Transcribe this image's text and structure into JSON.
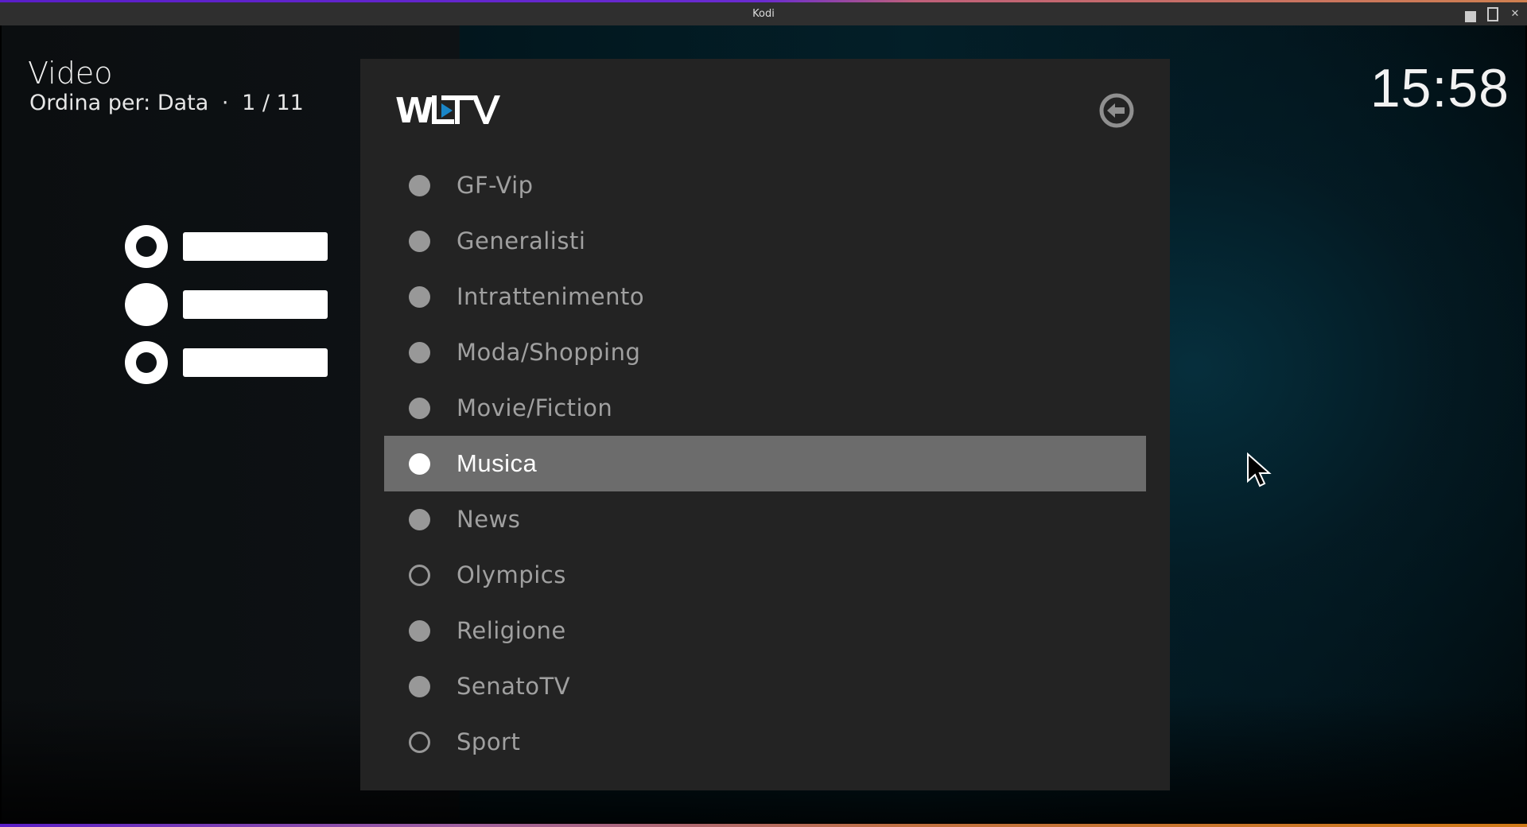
{
  "window": {
    "title": "Kodi",
    "controls": [
      "minimize",
      "maximize",
      "close"
    ]
  },
  "header": {
    "title": "Video",
    "sort_label": "Ordina per: Data",
    "separator": "·",
    "position": "1 / 11"
  },
  "clock": "15:58",
  "view_icon": "list-view-icon",
  "panel": {
    "logo_text": "WLTV",
    "logo_accent": "#1a86c8",
    "back_icon": "back-arrow-circle-icon",
    "items": [
      {
        "label": "GF-Vip",
        "state": "on",
        "focused": false
      },
      {
        "label": "Generalisti",
        "state": "on",
        "focused": false
      },
      {
        "label": "Intrattenimento",
        "state": "on",
        "focused": false
      },
      {
        "label": "Moda/Shopping",
        "state": "on",
        "focused": false
      },
      {
        "label": "Movie/Fiction",
        "state": "on",
        "focused": false
      },
      {
        "label": "Musica",
        "state": "on",
        "focused": true
      },
      {
        "label": "News",
        "state": "on",
        "focused": false
      },
      {
        "label": "Olympics",
        "state": "off",
        "focused": false
      },
      {
        "label": "Religione",
        "state": "on",
        "focused": false
      },
      {
        "label": "SenatoTV",
        "state": "on",
        "focused": false
      },
      {
        "label": "Sport",
        "state": "off",
        "focused": false
      }
    ]
  },
  "colors": {
    "panel_bg": "#232323",
    "focus_bg": "#6c6c6c",
    "item_text": "#a0a0a0",
    "radio": "#989898"
  }
}
